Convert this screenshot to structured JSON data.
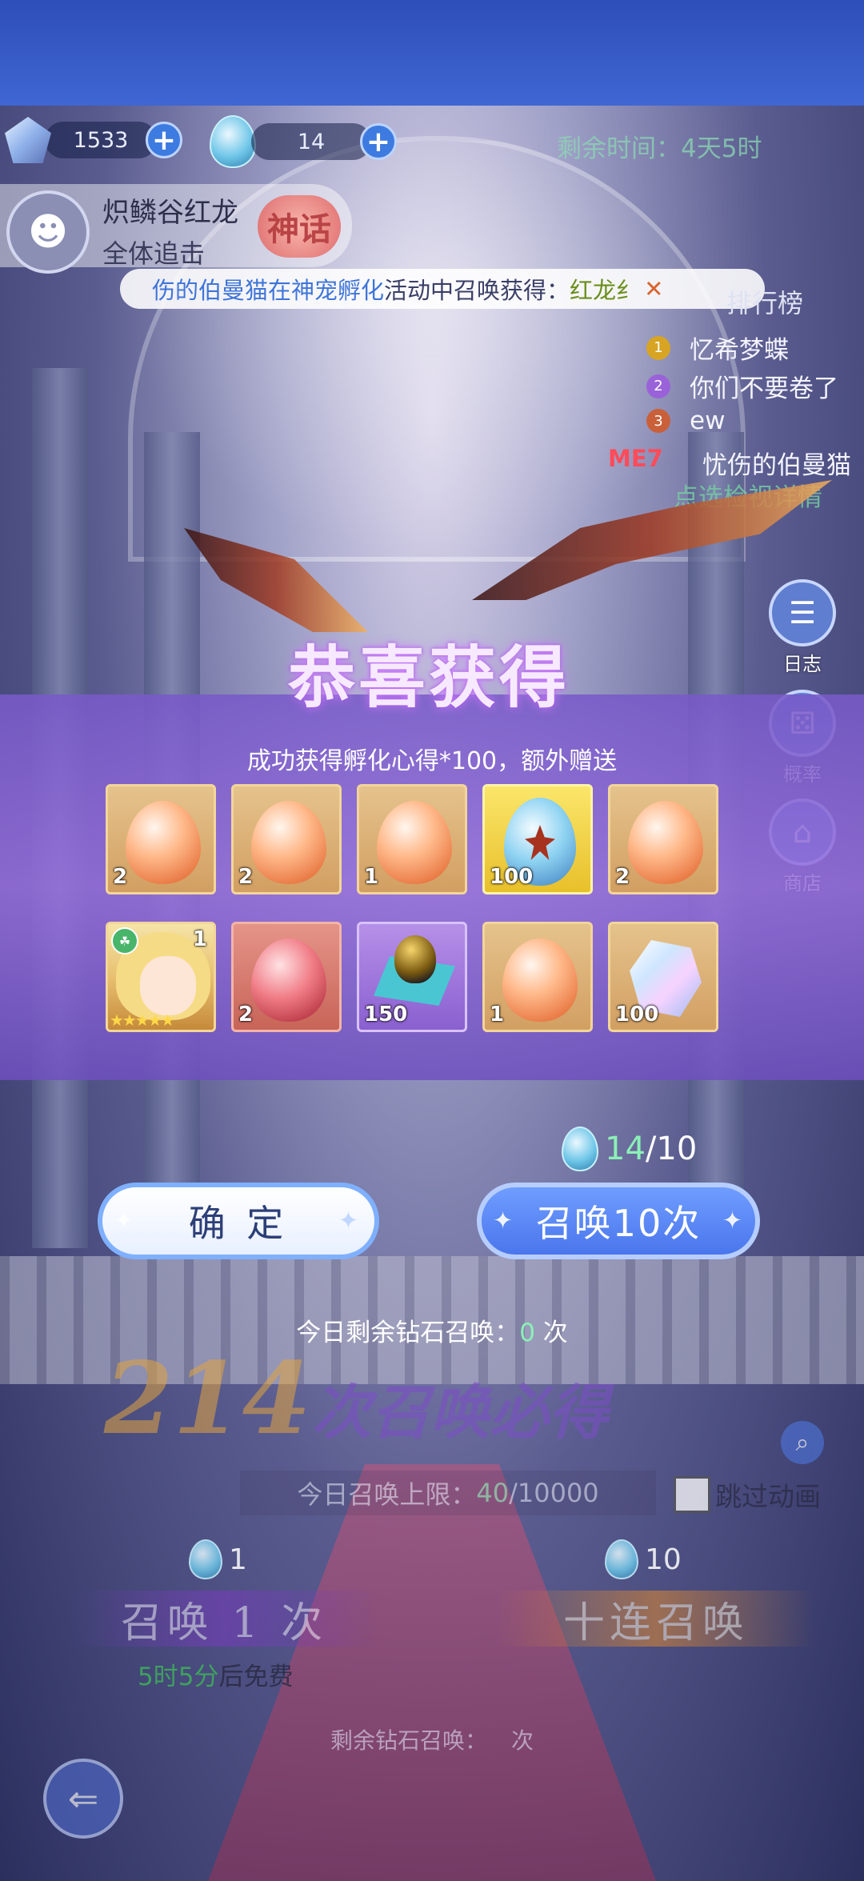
{
  "header": {
    "diamond_count": "1533",
    "egg_count": "14",
    "time_left_label": "剩余时间：",
    "time_left_value": "4天5时"
  },
  "pet": {
    "name": "炽鳞谷红龙",
    "subtitle": "全体追击",
    "rarity": "神话"
  },
  "marquee": {
    "part1": "伤的伯曼猫在",
    "event": "神宠孵化",
    "part2": "活动中召唤获得：",
    "reward": "红龙纟"
  },
  "ranking": {
    "title": "排行榜",
    "entries": [
      {
        "rank": "1",
        "name": "忆希梦蝶"
      },
      {
        "rank": "2",
        "name": "你们不要卷了"
      },
      {
        "rank": "3",
        "name": "ew"
      }
    ],
    "me_label": "ME",
    "me_rank": "7",
    "me_name": "忧伤的伯曼猫",
    "detail_link": "点选检视详情"
  },
  "side": {
    "log": "日志",
    "probability": "概率",
    "shop": "商店"
  },
  "reward_popup": {
    "title": "恭喜获得",
    "subtitle": "成功获得孵化心得*100，额外赠送",
    "items": [
      {
        "kind": "orange-egg",
        "count": "2"
      },
      {
        "kind": "orange-egg",
        "count": "2"
      },
      {
        "kind": "orange-egg",
        "count": "1"
      },
      {
        "kind": "dragon-egg",
        "count": "100"
      },
      {
        "kind": "orange-egg",
        "count": "2"
      },
      {
        "kind": "character-card",
        "count": "1"
      },
      {
        "kind": "red-egg",
        "count": "2"
      },
      {
        "kind": "gold-material",
        "count": "150"
      },
      {
        "kind": "orange-egg",
        "count": "1"
      },
      {
        "kind": "crystal",
        "count": "100"
      }
    ],
    "cost_have": "14",
    "cost_need": "/10",
    "confirm": "确 定",
    "summon_again": "召唤10次"
  },
  "summon": {
    "daily_diamond_label": "今日剩余钻石召唤：",
    "daily_diamond_value": "0",
    "daily_diamond_unit": "次",
    "pity_count": "214",
    "pity_text": "次召唤必得",
    "limit_label": "今日召唤上限：",
    "limit_value": "40",
    "limit_max": "/10000",
    "skip_animation": "跳过动画",
    "single_cost": "1",
    "ten_cost": "10",
    "single_label": "召唤 1 次",
    "ten_label": "十连召唤",
    "free_time": "5时5分",
    "free_suffix": "后免费",
    "remaining_label": "剩余钻石召唤：",
    "remaining_unit": "次"
  },
  "colors": {
    "accent_blue": "#4a76ec",
    "highlight_green": "#8cf0b7",
    "popup_purple": "#8c64d6"
  }
}
